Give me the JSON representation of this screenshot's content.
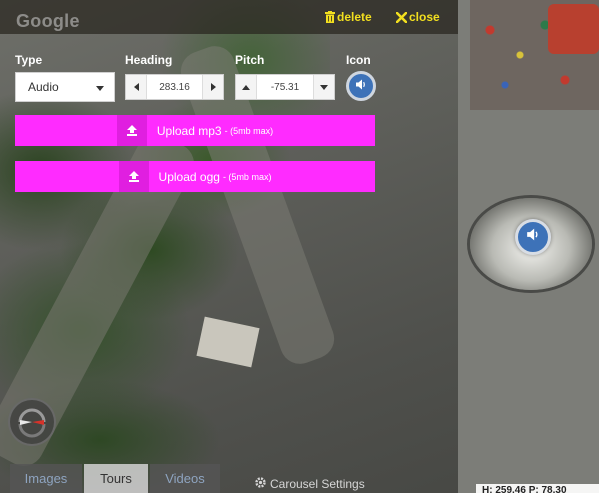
{
  "topbar": {
    "logo": "Google",
    "delete_label": "delete",
    "close_label": "close",
    "accent_color": "#f2df1f"
  },
  "editor": {
    "type": {
      "label": "Type",
      "value": "Audio"
    },
    "heading": {
      "label": "Heading",
      "value": "283.16"
    },
    "pitch": {
      "label": "Pitch",
      "value": "-75.31"
    },
    "icon": {
      "label": "Icon",
      "icon_name": "volume-icon"
    },
    "upload_mp3": {
      "label": "Upload mp3",
      "note": "- (5mb max)"
    },
    "upload_ogg": {
      "label": "Upload ogg",
      "note": "- (5mb max)"
    },
    "upload_color": "#ff2bff"
  },
  "hotspot": {
    "icon_name": "volume-icon",
    "color": "#3d72b8"
  },
  "bottom": {
    "tabs": [
      {
        "label": "Images"
      },
      {
        "label": "Tours"
      },
      {
        "label": "Videos"
      }
    ],
    "carousel_settings": "Carousel Settings"
  },
  "readout": {
    "h_label": "H:",
    "h_value": "259.46",
    "p_label": "P:",
    "p_value": "78.30"
  }
}
